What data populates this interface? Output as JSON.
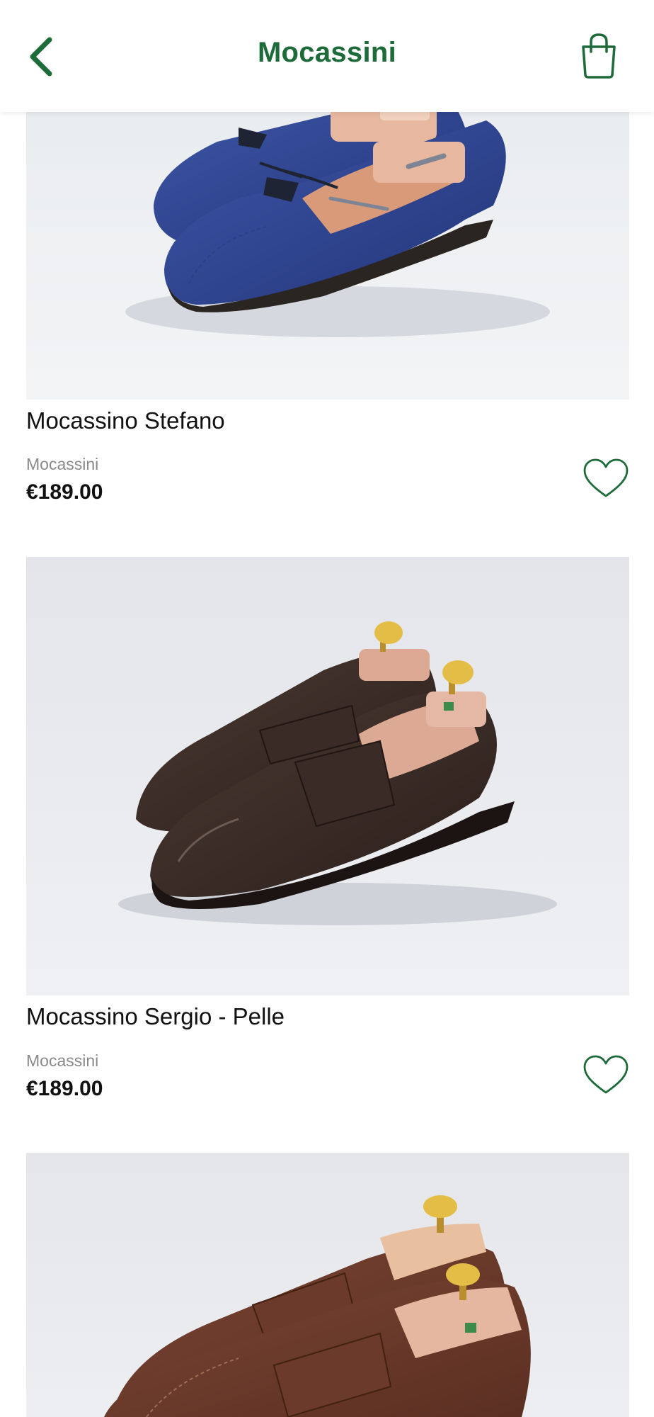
{
  "header": {
    "title": "Mocassini",
    "back_icon": "chevron-left-icon",
    "cart_icon": "shopping-bag-icon",
    "accent_color": "#1e6b3a"
  },
  "products": [
    {
      "name": "Mocassino Stefano",
      "category": "Mocassini",
      "price": "€189.00",
      "favorite_icon": "heart-icon",
      "shoe_color": "#2e4287"
    },
    {
      "name": "Mocassino Sergio - Pelle",
      "category": "Mocassini",
      "price": "€189.00",
      "favorite_icon": "heart-icon",
      "shoe_color": "#3a2b27"
    },
    {
      "name": "",
      "category": "",
      "price": "",
      "favorite_icon": "heart-icon",
      "shoe_color": "#6b3a2a"
    }
  ]
}
